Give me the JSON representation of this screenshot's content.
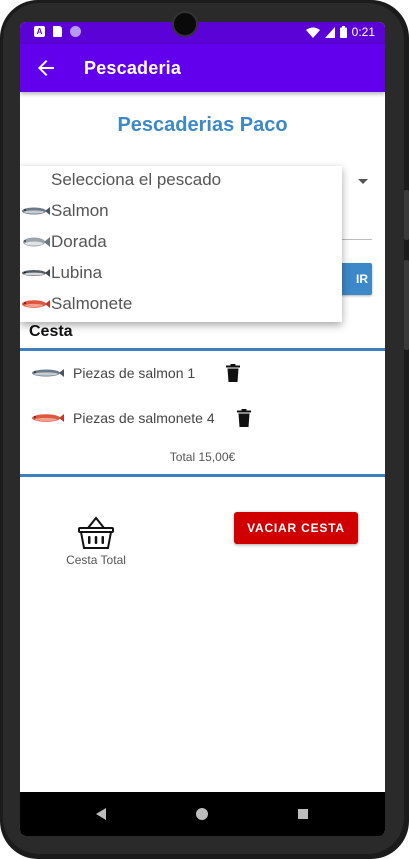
{
  "status_bar": {
    "time": "0:21",
    "notif_a": "A"
  },
  "app_bar": {
    "title": "Pescaderia"
  },
  "shop_title": "Pescaderias Paco",
  "dropdown": {
    "header": "Selecciona el pescado",
    "items": [
      {
        "label": "Salmon",
        "icon": "salmon-fish-icon"
      },
      {
        "label": "Dorada",
        "icon": "dorada-fish-icon"
      },
      {
        "label": "Lubina",
        "icon": "lubina-fish-icon"
      },
      {
        "label": "Salmonete",
        "icon": "salmonete-fish-icon"
      }
    ]
  },
  "add_button": {
    "label": "IR"
  },
  "basket": {
    "title": "Cesta",
    "items": [
      {
        "text": "Piezas de salmon 1",
        "icon": "salmon-fish-icon"
      },
      {
        "text": "Piezas de salmonete 4",
        "icon": "salmonete-fish-icon"
      }
    ],
    "total": "Total 15,00€"
  },
  "footer": {
    "basket_label": "Cesta Total",
    "empty_button": "VACIAR CESTA"
  },
  "colors": {
    "primary": "#6200ee",
    "status_bar": "#5b03d6",
    "title_blue": "#3d88c8",
    "danger": "#d10000"
  }
}
